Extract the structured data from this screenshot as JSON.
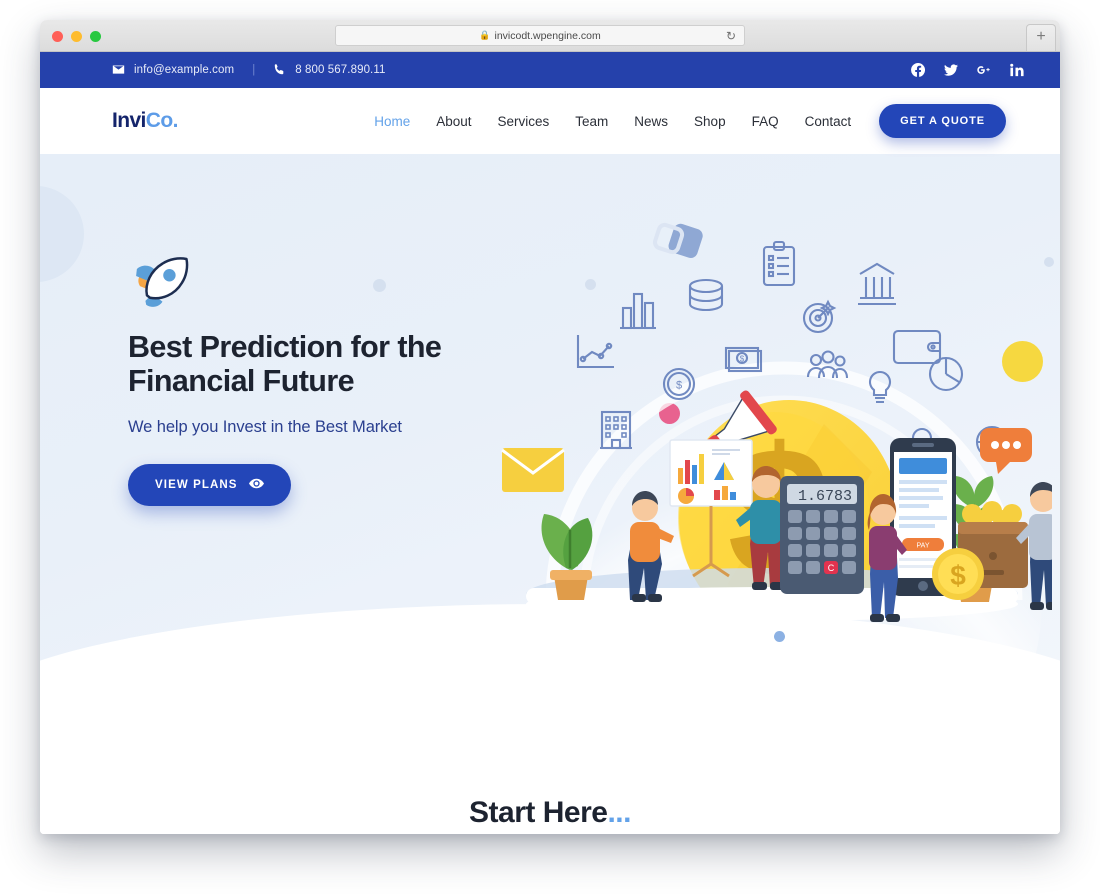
{
  "browser": {
    "url": "invicodt.wpengine.com",
    "lock_icon": "lock-icon",
    "reload_icon": "reload-icon",
    "newtab_label": "+",
    "traffic_lights": [
      "close",
      "minimize",
      "maximize"
    ]
  },
  "topbar": {
    "email": "info@example.com",
    "email_icon": "envelope-icon",
    "separator": "|",
    "phone": "8 800 567.890.11",
    "phone_icon": "phone-icon",
    "background": "#2541ab",
    "social": [
      {
        "name": "facebook-icon",
        "label": "Facebook"
      },
      {
        "name": "twitter-icon",
        "label": "Twitter"
      },
      {
        "name": "google-plus-icon",
        "label": "Google Plus"
      },
      {
        "name": "linkedin-icon",
        "label": "LinkedIn"
      }
    ]
  },
  "header": {
    "logo_primary": "Invi",
    "logo_accent": "Co.",
    "logo_primary_color": "#14246b",
    "logo_accent_color": "#5d9ce8",
    "nav": [
      {
        "label": "Home",
        "active": true
      },
      {
        "label": "About",
        "active": false
      },
      {
        "label": "Services",
        "active": false
      },
      {
        "label": "Team",
        "active": false
      },
      {
        "label": "News",
        "active": false
      },
      {
        "label": "Shop",
        "active": false
      },
      {
        "label": "FAQ",
        "active": false
      },
      {
        "label": "Contact",
        "active": false
      }
    ],
    "cta_label": "GET A QUOTE",
    "cta_color": "#2346b8",
    "active_color": "#63a2e9"
  },
  "hero": {
    "rocket_icon": "rocket-icon",
    "title_line1": "Best Prediction for the",
    "title_line2": "Financial Future",
    "subtitle": "We help you Invest in the Best Market",
    "button_label": "VIEW PLANS",
    "button_icon": "eye-icon",
    "button_color": "#2346b8",
    "background_gradient": [
      "#e6eef8",
      "#f2f6fb"
    ],
    "accent_yellow": "#f6d840",
    "accent_pink": "#e8628f",
    "slider_dot_color": "#8cb1e3",
    "illustration": {
      "name": "financial-investment-illustration",
      "calculator_display": "1.6783",
      "phone_button_label": "PAY",
      "coin_symbol": "$",
      "floating_icons": [
        "bar-chart-icon",
        "line-graph-icon",
        "coin-stack-icon",
        "clipboard-icon",
        "bank-icon",
        "target-icon",
        "wallet-icon",
        "banknote-icon",
        "people-icon",
        "lightbulb-icon",
        "pie-chart-icon",
        "dollar-coin-icon",
        "office-building-icon",
        "clock-icon",
        "magnifier-icon",
        "chat-bubble-icon",
        "envelope-icon",
        "megaphone-icon",
        "cube-icon"
      ]
    }
  },
  "start_section": {
    "title": "Start Here",
    "dots": "...",
    "dots_color": "#63a2e9"
  }
}
